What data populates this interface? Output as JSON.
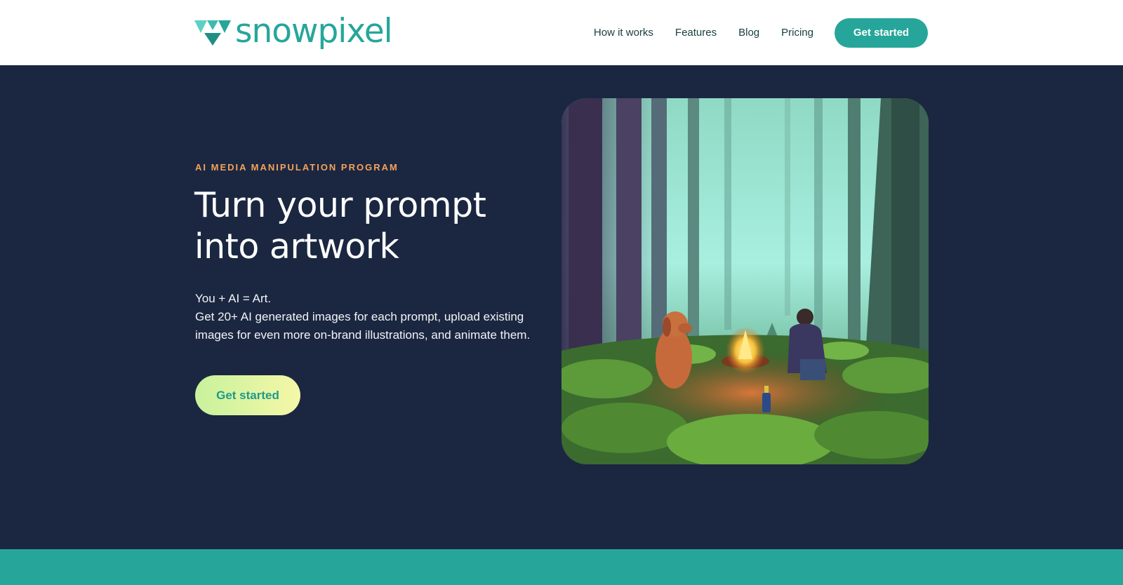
{
  "header": {
    "logo_text": "snowpixel",
    "logo_icon": "snowpixel-triangle-logo-icon",
    "nav": [
      {
        "label": "How it works"
      },
      {
        "label": "Features"
      },
      {
        "label": "Blog"
      },
      {
        "label": "Pricing"
      }
    ],
    "cta_label": "Get started"
  },
  "hero": {
    "eyebrow": "AI MEDIA MANIPULATION PROGRAM",
    "headline": "Turn your prompt into artwork",
    "subtitle_line1": "You + AI = Art.",
    "subtitle_line2": "Get 20+ AI generated images for each prompt, upload existing images for even more on-brand illustrations, and animate them.",
    "cta_label": "Get started",
    "image_name": "forest-campfire-artwork"
  },
  "colors": {
    "brand_teal": "#26a69a",
    "hero_bg": "#1b2740",
    "eyebrow_orange": "#f5a25a",
    "cta_gradient_start": "#c8f29c",
    "cta_gradient_end": "#f5f7a8"
  }
}
